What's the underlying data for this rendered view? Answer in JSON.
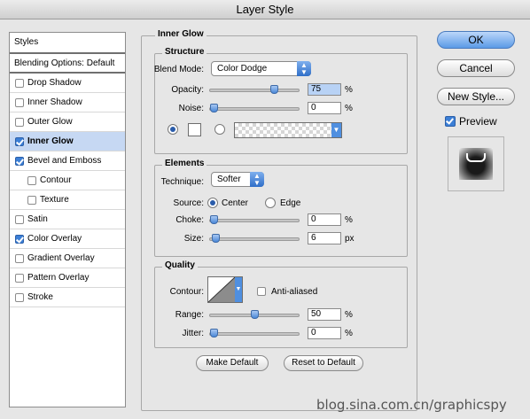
{
  "window": {
    "title": "Layer Style"
  },
  "styles_list": {
    "header": "Styles",
    "blending": "Blending Options: Default",
    "items": [
      {
        "label": "Drop Shadow",
        "checked": false,
        "selected": false,
        "sub": false
      },
      {
        "label": "Inner Shadow",
        "checked": false,
        "selected": false,
        "sub": false
      },
      {
        "label": "Outer Glow",
        "checked": false,
        "selected": false,
        "sub": false
      },
      {
        "label": "Inner Glow",
        "checked": true,
        "selected": true,
        "sub": false
      },
      {
        "label": "Bevel and Emboss",
        "checked": true,
        "selected": false,
        "sub": false
      },
      {
        "label": "Contour",
        "checked": false,
        "selected": false,
        "sub": true
      },
      {
        "label": "Texture",
        "checked": false,
        "selected": false,
        "sub": true
      },
      {
        "label": "Satin",
        "checked": false,
        "selected": false,
        "sub": false
      },
      {
        "label": "Color Overlay",
        "checked": true,
        "selected": false,
        "sub": false
      },
      {
        "label": "Gradient Overlay",
        "checked": false,
        "selected": false,
        "sub": false
      },
      {
        "label": "Pattern Overlay",
        "checked": false,
        "selected": false,
        "sub": false
      },
      {
        "label": "Stroke",
        "checked": false,
        "selected": false,
        "sub": false
      }
    ]
  },
  "inner_glow": {
    "title": "Inner Glow",
    "structure": {
      "title": "Structure",
      "blend_mode_label": "Blend Mode:",
      "blend_mode_value": "Color Dodge",
      "opacity_label": "Opacity:",
      "opacity_value": "75",
      "opacity_level": 0.75,
      "noise_label": "Noise:",
      "noise_value": "0",
      "noise_level": 0,
      "percent": "%"
    },
    "elements": {
      "title": "Elements",
      "technique_label": "Technique:",
      "technique_value": "Softer",
      "source_label": "Source:",
      "source_center": "Center",
      "source_edge": "Edge",
      "choke_label": "Choke:",
      "choke_value": "0",
      "choke_level": 0,
      "size_label": "Size:",
      "size_value": "6",
      "size_level": 0.024,
      "percent": "%",
      "px": "px"
    },
    "quality": {
      "title": "Quality",
      "contour_label": "Contour:",
      "antialiased_label": "Anti-aliased",
      "range_label": "Range:",
      "range_value": "50",
      "range_level": 0.5,
      "jitter_label": "Jitter:",
      "jitter_value": "0",
      "jitter_level": 0,
      "percent": "%"
    },
    "make_default": "Make Default",
    "reset_default": "Reset to Default"
  },
  "buttons": {
    "ok": "OK",
    "cancel": "Cancel",
    "new_style": "New Style...",
    "preview": "Preview"
  },
  "watermark": "blog.sina.com.cn/graphicspy"
}
